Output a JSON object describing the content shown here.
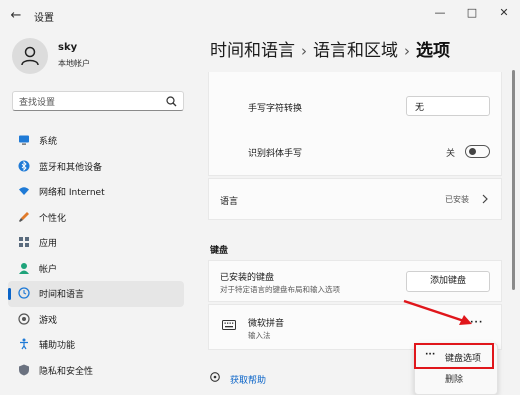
{
  "window": {
    "back_glyph": "←",
    "title": "设置",
    "minimize": "—",
    "maximize": "□",
    "close": "✕"
  },
  "user": {
    "name": "sky",
    "account_type": "本地帐户"
  },
  "search": {
    "placeholder": "查找设置"
  },
  "nav": {
    "items": [
      {
        "label": "系统",
        "icon": "monitor-icon"
      },
      {
        "label": "蓝牙和其他设备",
        "icon": "bluetooth-icon"
      },
      {
        "label": "网络和 Internet",
        "icon": "wifi-icon"
      },
      {
        "label": "个性化",
        "icon": "brush-icon"
      },
      {
        "label": "应用",
        "icon": "apps-icon"
      },
      {
        "label": "帐户",
        "icon": "person-icon"
      },
      {
        "label": "时间和语言",
        "icon": "globe-clock-icon",
        "active": true
      },
      {
        "label": "游戏",
        "icon": "gamepad-icon"
      },
      {
        "label": "辅助功能",
        "icon": "accessibility-icon"
      },
      {
        "label": "隐私和安全性",
        "icon": "shield-icon"
      }
    ]
  },
  "breadcrumb": {
    "level1": "时间和语言",
    "level2": "语言和区域",
    "current": "选项",
    "separator": "›"
  },
  "handwriting": {
    "label": "手写字符转换",
    "value": "无"
  },
  "cursive": {
    "label": "识别斜体手写",
    "state": "关"
  },
  "language": {
    "label": "语言",
    "status": "已安装"
  },
  "keyboard": {
    "section_title": "键盘",
    "installed_label": "已安装的键盘",
    "installed_sub": "对于特定语言的键盘布局和输入选项",
    "add_button": "添加键盘",
    "ime_name": "微软拼音",
    "ime_sub": "输入法",
    "more_glyph": "···",
    "menu_options": "键盘选项",
    "menu_remove": "删除"
  },
  "help": {
    "label": "获取帮助"
  },
  "colors": {
    "accent": "#0a64c8",
    "annotation_red": "#e0161b"
  }
}
